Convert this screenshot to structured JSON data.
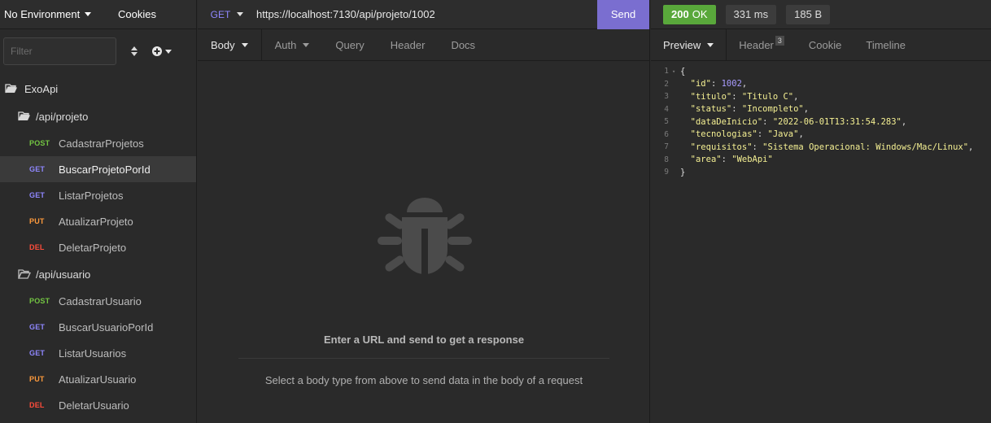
{
  "sidebar": {
    "environment": "No Environment",
    "cookies": "Cookies",
    "filter_placeholder": "Filter",
    "workspace": "ExoApi",
    "folders": [
      {
        "name": "/api/projeto",
        "requests": [
          {
            "method": "POST",
            "name": "CadastrarProjetos"
          },
          {
            "method": "GET",
            "name": "BuscarProjetoPorId"
          },
          {
            "method": "GET",
            "name": "ListarProjetos"
          },
          {
            "method": "PUT",
            "name": "AtualizarProjeto"
          },
          {
            "method": "DEL",
            "name": "DeletarProjeto"
          }
        ]
      },
      {
        "name": "/api/usuario",
        "requests": [
          {
            "method": "POST",
            "name": "CadastrarUsuario"
          },
          {
            "method": "GET",
            "name": "BuscarUsuarioPorId"
          },
          {
            "method": "GET",
            "name": "ListarUsuarios"
          },
          {
            "method": "PUT",
            "name": "AtualizarUsuario"
          },
          {
            "method": "DEL",
            "name": "DeletarUsuario"
          }
        ]
      }
    ]
  },
  "request": {
    "method": "GET",
    "url": "https://localhost:7130/api/projeto/1002",
    "send_label": "Send",
    "tabs": [
      "Body",
      "Auth",
      "Query",
      "Header",
      "Docs"
    ],
    "empty_title": "Enter a URL and send to get a response",
    "empty_subtitle": "Select a body type from above to send data in the body of a request"
  },
  "response": {
    "status_code": "200",
    "status_text": "OK",
    "time": "331 ms",
    "size": "185 B",
    "tabs": {
      "preview": "Preview",
      "header": "Header",
      "header_count": "3",
      "cookie": "Cookie",
      "timeline": "Timeline"
    },
    "body_lines": [
      {
        "n": "1",
        "fold": true,
        "parts": [
          {
            "t": "{",
            "c": "p"
          }
        ]
      },
      {
        "n": "2",
        "parts": [
          {
            "t": "  ",
            "c": "p"
          },
          {
            "t": "\"id\"",
            "c": "k"
          },
          {
            "t": ": ",
            "c": "p"
          },
          {
            "t": "1002",
            "c": "n"
          },
          {
            "t": ",",
            "c": "p"
          }
        ]
      },
      {
        "n": "3",
        "parts": [
          {
            "t": "  ",
            "c": "p"
          },
          {
            "t": "\"titulo\"",
            "c": "k"
          },
          {
            "t": ": ",
            "c": "p"
          },
          {
            "t": "\"Titulo C\"",
            "c": "s"
          },
          {
            "t": ",",
            "c": "p"
          }
        ]
      },
      {
        "n": "4",
        "parts": [
          {
            "t": "  ",
            "c": "p"
          },
          {
            "t": "\"status\"",
            "c": "k"
          },
          {
            "t": ": ",
            "c": "p"
          },
          {
            "t": "\"Incompleto\"",
            "c": "s"
          },
          {
            "t": ",",
            "c": "p"
          }
        ]
      },
      {
        "n": "5",
        "parts": [
          {
            "t": "  ",
            "c": "p"
          },
          {
            "t": "\"dataDeInicio\"",
            "c": "k"
          },
          {
            "t": ": ",
            "c": "p"
          },
          {
            "t": "\"2022-06-01T13:31:54.283\"",
            "c": "s"
          },
          {
            "t": ",",
            "c": "p"
          }
        ]
      },
      {
        "n": "6",
        "parts": [
          {
            "t": "  ",
            "c": "p"
          },
          {
            "t": "\"tecnologias\"",
            "c": "k"
          },
          {
            "t": ": ",
            "c": "p"
          },
          {
            "t": "\"Java\"",
            "c": "s"
          },
          {
            "t": ",",
            "c": "p"
          }
        ]
      },
      {
        "n": "7",
        "parts": [
          {
            "t": "  ",
            "c": "p"
          },
          {
            "t": "\"requisitos\"",
            "c": "k"
          },
          {
            "t": ": ",
            "c": "p"
          },
          {
            "t": "\"Sistema Operacional: Windows/Mac/Linux\"",
            "c": "s"
          },
          {
            "t": ",",
            "c": "p"
          }
        ]
      },
      {
        "n": "8",
        "parts": [
          {
            "t": "  ",
            "c": "p"
          },
          {
            "t": "\"area\"",
            "c": "k"
          },
          {
            "t": ": ",
            "c": "p"
          },
          {
            "t": "\"WebApi\"",
            "c": "s"
          }
        ]
      },
      {
        "n": "9",
        "parts": [
          {
            "t": "}",
            "c": "p"
          }
        ]
      }
    ]
  },
  "colors": {
    "post": "#73c542",
    "get": "#8f87ff",
    "put": "#ff9a3c",
    "del": "#ff4c3b",
    "send": "#7a6ed0",
    "ok": "#59a83b"
  }
}
